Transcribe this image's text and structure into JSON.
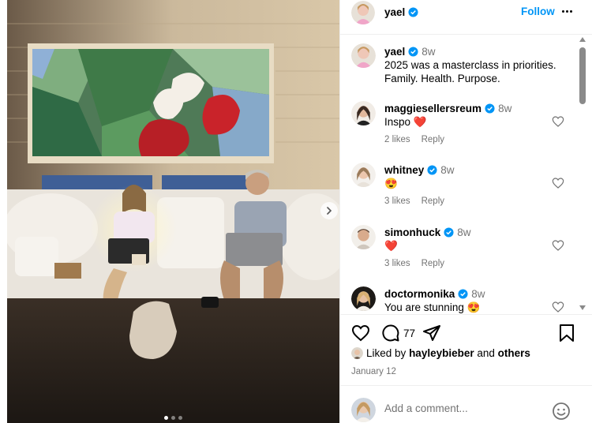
{
  "post": {
    "author": "yael",
    "follow_label": "Follow",
    "carousel": {
      "total_slides": 3,
      "active_slide": 1
    }
  },
  "caption": {
    "username": "yael",
    "time": "8w",
    "line1": "2025 was a masterclass in priorities.",
    "line2": "Family. Health. Purpose."
  },
  "comments": [
    {
      "username": "maggiesellersreum",
      "time": "8w",
      "text": "Inspo",
      "emoji": "❤️",
      "likes": "2 likes",
      "reply": "Reply"
    },
    {
      "username": "whitney",
      "time": "8w",
      "text": "",
      "emoji": "😍",
      "likes": "3 likes",
      "reply": "Reply"
    },
    {
      "username": "simonhuck",
      "time": "8w",
      "text": "",
      "emoji": "❤️",
      "likes": "3 likes",
      "reply": "Reply"
    },
    {
      "username": "doctormonika",
      "time": "8w",
      "text": "You are stunning",
      "emoji": "😍",
      "likes": "",
      "reply": ""
    }
  ],
  "engagement": {
    "comment_count": "77",
    "liked_prefix": "Liked by",
    "liked_user": "hayleybieber",
    "liked_and": "and",
    "liked_others": "others",
    "date": "January 12"
  },
  "add_comment": {
    "placeholder": "Add a comment..."
  },
  "icons": {
    "verified": "verified-badge-icon",
    "heart": "heart-icon",
    "comment": "comment-bubble-icon",
    "share": "paper-plane-icon",
    "save": "bookmark-icon",
    "emoji": "smiley-icon",
    "more": "more-dots-icon",
    "next": "chevron-right-icon"
  },
  "colors": {
    "accent": "#0095f6",
    "verified": "#0095f6",
    "muted": "#737373"
  }
}
